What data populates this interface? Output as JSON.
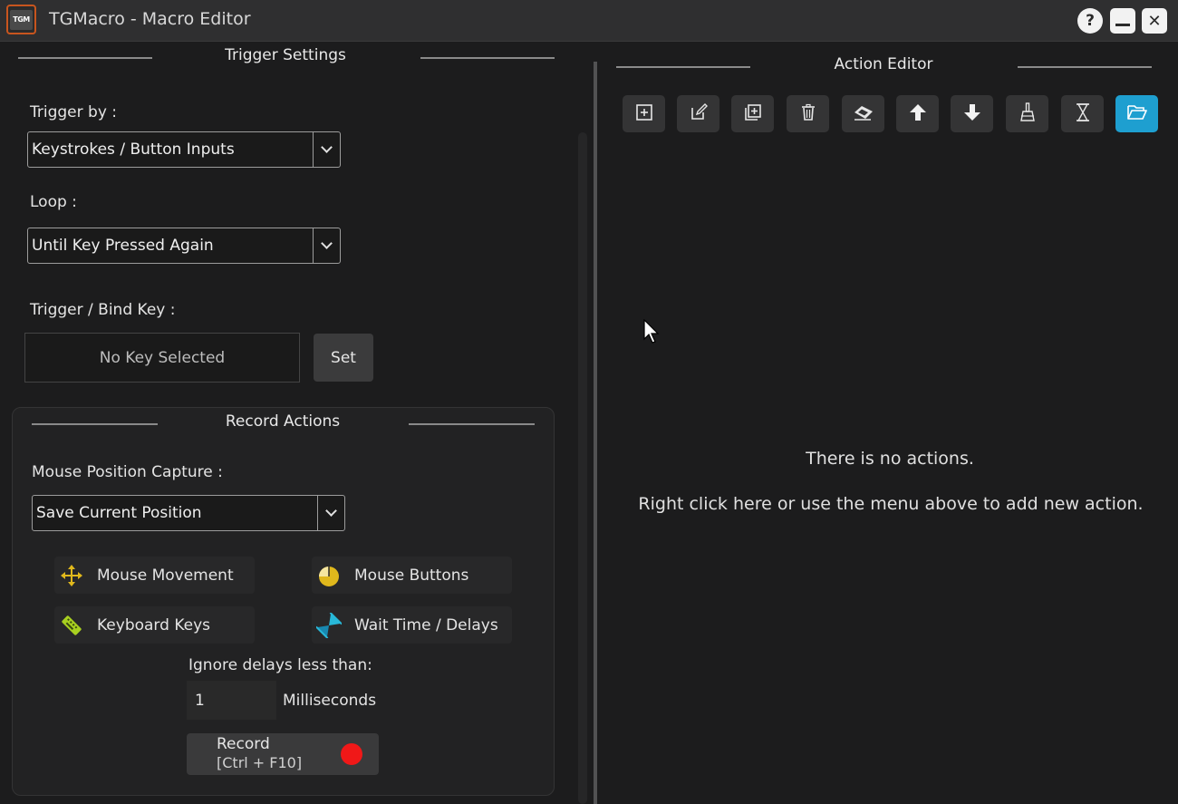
{
  "window": {
    "logo_text": "TGM",
    "title": "TGMacro - Macro Editor",
    "help_label": "?",
    "close_label": "✕"
  },
  "trigger_settings": {
    "header": "Trigger Settings",
    "trigger_by_label": "Trigger by :",
    "trigger_by_value": "Keystrokes / Button Inputs",
    "loop_label": "Loop :",
    "loop_value": "Until Key Pressed Again",
    "bind_key_label": "Trigger / Bind Key :",
    "bind_key_value": "No Key Selected",
    "set_label": "Set"
  },
  "record_actions": {
    "header": "Record Actions",
    "mouse_capture_label": "Mouse Position Capture :",
    "mouse_capture_value": "Save Current Position",
    "toggles": {
      "mouse_movement": "Mouse Movement",
      "mouse_buttons": "Mouse Buttons",
      "keyboard_keys": "Keyboard Keys",
      "wait_time": "Wait Time / Delays"
    },
    "ignore_label": "Ignore delays less than:",
    "ignore_value": "1",
    "ignore_unit": "Milliseconds",
    "record_label": "Record",
    "record_shortcut": "[Ctrl + F10]"
  },
  "action_editor": {
    "header": "Action Editor",
    "toolbar": [
      "add-icon",
      "edit-icon",
      "duplicate-icon",
      "delete-icon",
      "eraser-icon",
      "move-up-icon",
      "move-down-icon",
      "clear-icon",
      "wait-icon",
      "open-folder-icon"
    ],
    "empty_title": "There is no actions.",
    "empty_hint": "Right click here or use the menu above to add new action."
  },
  "colors": {
    "accent": "#1e9fd0",
    "record_dot": "#f01818",
    "icon_yellow": "#e0b81c",
    "icon_green": "#a8d020",
    "icon_cyan": "#28b8d8"
  }
}
